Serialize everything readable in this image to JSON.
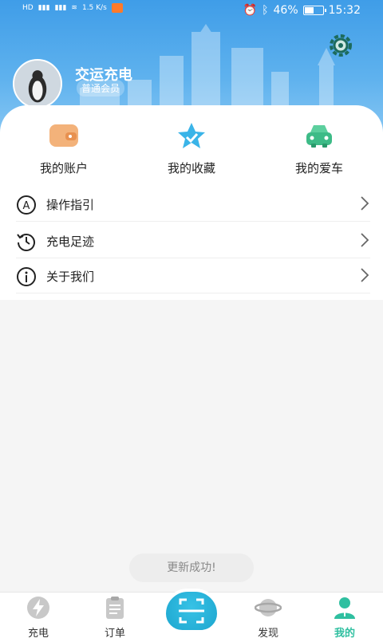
{
  "status_bar": {
    "network": "1.5 K/s",
    "battery": "46%",
    "time": "15:32",
    "hd1": "HD",
    "hd2": "HD"
  },
  "profile": {
    "name": "交运充电",
    "level": "普通会员",
    "settings_icon": "gear-icon"
  },
  "quick_actions": [
    {
      "label": "我的账户",
      "icon": "wallet-icon"
    },
    {
      "label": "我的收藏",
      "icon": "star-icon"
    },
    {
      "label": "我的爱车",
      "icon": "car-icon"
    }
  ],
  "menu": [
    {
      "label": "操作指引",
      "icon": "guide-icon"
    },
    {
      "label": "充电足迹",
      "icon": "history-icon"
    },
    {
      "label": "关于我们",
      "icon": "info-icon"
    }
  ],
  "toast": "更新成功!",
  "nav": {
    "tabs": [
      {
        "label": "充电",
        "icon": "lightning-icon"
      },
      {
        "label": "订单",
        "icon": "clipboard-icon"
      },
      {
        "label": "发现",
        "icon": "planet-icon"
      },
      {
        "label": "我的",
        "icon": "user-icon"
      }
    ],
    "active": "我的",
    "scan_icon": "scan-icon"
  },
  "colors": {
    "header": "#3f9de8",
    "accent": "#2fbfa0",
    "scan": "#1da6cf"
  }
}
